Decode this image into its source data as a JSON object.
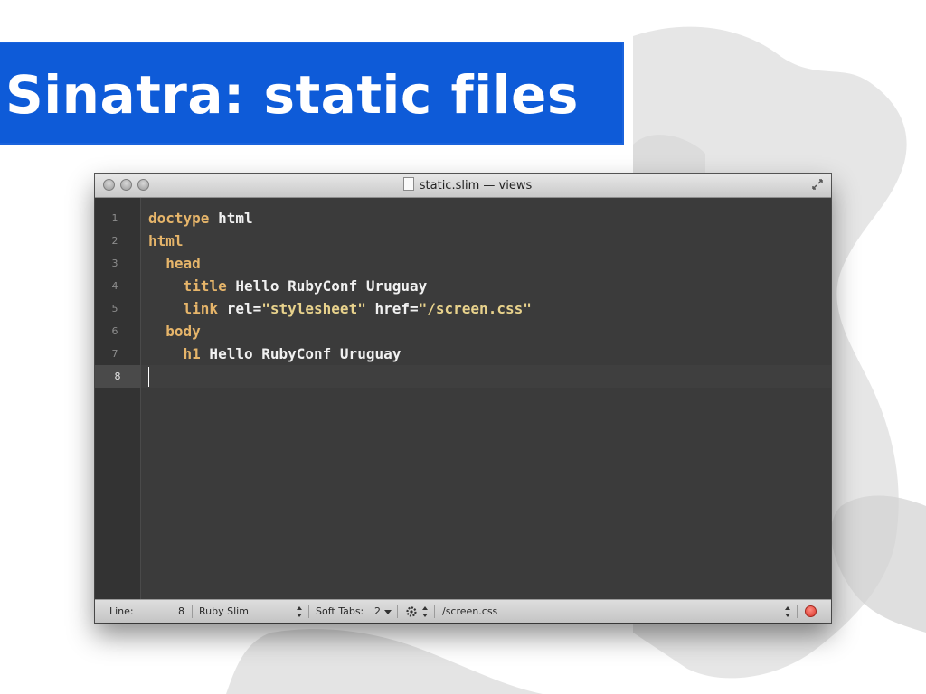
{
  "slide": {
    "title": "Sinatra: static files",
    "banner_color": "#0e5bd8"
  },
  "window": {
    "title": "static.slim — views",
    "file_icon": "document-icon",
    "fullscreen_icon": "fullscreen-arrows-icon"
  },
  "editor": {
    "line_numbers": [
      "1",
      "2",
      "3",
      "4",
      "5",
      "6",
      "7",
      "8"
    ],
    "current_line": 8,
    "lines": [
      {
        "indent": "",
        "keyword": "doctype",
        "rest": " html",
        "string": ""
      },
      {
        "indent": "",
        "keyword": "html",
        "rest": "",
        "string": ""
      },
      {
        "indent": "  ",
        "keyword": "head",
        "rest": "",
        "string": ""
      },
      {
        "indent": "    ",
        "keyword": "title",
        "rest": " Hello RubyConf Uruguay",
        "string": ""
      },
      {
        "indent": "    ",
        "keyword": "link",
        "rest": " rel=",
        "string": "\"stylesheet\"",
        "rest2": " href=",
        "string2": "\"/screen.css\""
      },
      {
        "indent": "  ",
        "keyword": "body",
        "rest": "",
        "string": ""
      },
      {
        "indent": "    ",
        "keyword": "h1",
        "rest": " Hello RubyConf Uruguay",
        "string": ""
      },
      {
        "indent": "",
        "keyword": "",
        "rest": "",
        "string": ""
      }
    ]
  },
  "statusbar": {
    "line_label": "Line:",
    "line_value": "8",
    "syntax": "Ruby Slim",
    "tabs_label": "Soft Tabs:",
    "tabs_value": "2",
    "symbol": "/screen.css",
    "gear_icon": "gear-icon",
    "record_color": "#d8352a"
  }
}
